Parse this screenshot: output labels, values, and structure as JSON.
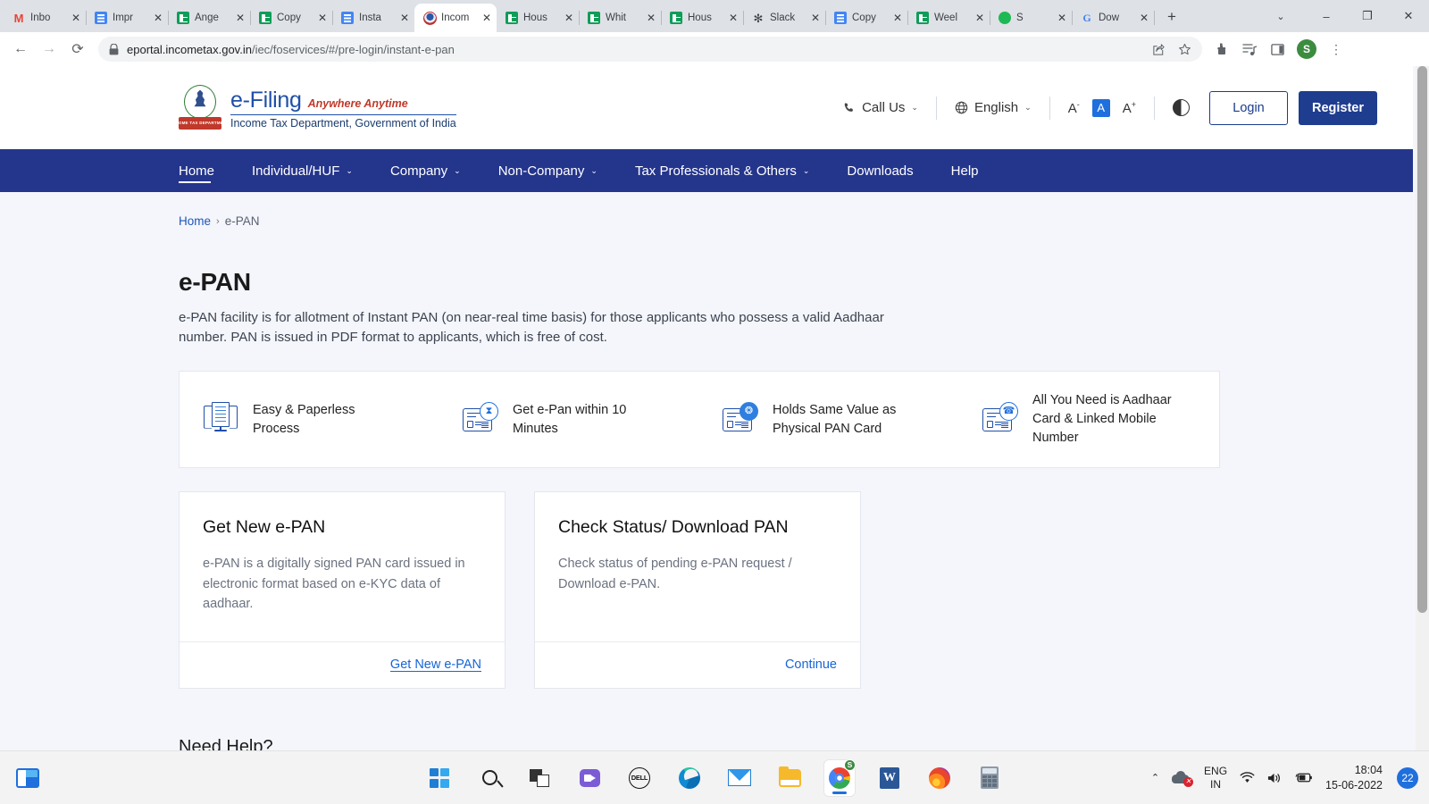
{
  "browser": {
    "tabs": [
      {
        "title": "Inbo",
        "icon": "gmail-icon",
        "active": false
      },
      {
        "title": "Impr",
        "icon": "google-docs-icon",
        "active": false
      },
      {
        "title": "Ange",
        "icon": "google-sheets-icon",
        "active": false
      },
      {
        "title": "Copy",
        "icon": "google-sheets-icon",
        "active": false
      },
      {
        "title": "Insta",
        "icon": "google-docs-icon",
        "active": false
      },
      {
        "title": "Incom",
        "icon": "income-tax-emblem-icon",
        "active": true
      },
      {
        "title": "Hous",
        "icon": "google-sheets-icon",
        "active": false
      },
      {
        "title": "Whit",
        "icon": "google-sheets-icon",
        "active": false
      },
      {
        "title": "Hous",
        "icon": "google-sheets-icon",
        "active": false
      },
      {
        "title": "Slack",
        "icon": "slack-icon",
        "active": false
      },
      {
        "title": "Copy",
        "icon": "google-docs-icon",
        "active": false
      },
      {
        "title": "Weel",
        "icon": "google-sheets-icon",
        "active": false
      },
      {
        "title": "S",
        "icon": "spotify-icon",
        "active": false
      },
      {
        "title": "Dow",
        "icon": "google-icon",
        "active": false
      }
    ],
    "new_tab_label": "+",
    "close_label": "✕",
    "window_controls": {
      "search_tabs": "⌄",
      "minimize": "–",
      "maximize": "❐",
      "close": "✕"
    },
    "toolbar": {
      "back": "←",
      "forward": "→",
      "reload": "⟳",
      "lock_icon": "lock-icon",
      "url": "eportal.incometax.gov.in",
      "url_path": "/iec/foservices/#/pre-login/instant-e-pan",
      "share": "share-icon",
      "bookmark": "star-icon",
      "extensions": "puzzle-icon",
      "media": "media-playlist-icon",
      "side_panel": "side-panel-icon",
      "profile_initial": "S",
      "menu": "⋮"
    }
  },
  "site": {
    "brand": {
      "emblem_text": "INCOME TAX DEPARTMENT",
      "title": "e-Filing",
      "tagline": "Anywhere Anytime",
      "subtitle": "Income Tax Department, Government of India"
    },
    "header_actions": {
      "call_us": "Call Us",
      "language": "English",
      "font_decrease": "A",
      "font_normal": "A",
      "font_increase": "A",
      "contrast": "contrast-icon",
      "login": "Login",
      "register": "Register"
    },
    "nav": [
      {
        "label": "Home",
        "has_caret": false,
        "active": true
      },
      {
        "label": "Individual/HUF",
        "has_caret": true,
        "active": false
      },
      {
        "label": "Company",
        "has_caret": true,
        "active": false
      },
      {
        "label": "Non-Company",
        "has_caret": true,
        "active": false
      },
      {
        "label": "Tax Professionals & Others",
        "has_caret": true,
        "active": false
      },
      {
        "label": "Downloads",
        "has_caret": false,
        "active": false
      },
      {
        "label": "Help",
        "has_caret": false,
        "active": false
      }
    ],
    "breadcrumb": {
      "home": "Home",
      "separator": "›",
      "current": "e-PAN"
    },
    "page": {
      "title": "e-PAN",
      "description": "e-PAN facility is for allotment of Instant PAN (on near-real time basis) for those applicants who possess a valid Aadhaar number. PAN is issued in PDF format to applicants, which is free of cost."
    },
    "features": [
      {
        "label": "Easy & Paperless Process",
        "icon": "monitor-document-icon"
      },
      {
        "label": "Get e-Pan within 10 Minutes",
        "icon": "id-card-hourglass-icon"
      },
      {
        "label": "Holds Same Value as Physical PAN Card",
        "icon": "id-card-fingerprint-icon"
      },
      {
        "label": "All You Need is Aadhaar Card & Linked Mobile Number",
        "icon": "id-card-clock-icon"
      }
    ],
    "cards": [
      {
        "title": "Get New e-PAN",
        "description": "e-PAN is a digitally signed PAN card issued in electronic format based on e-KYC data of aadhaar.",
        "link": "Get New e-PAN",
        "link_underlined": true
      },
      {
        "title": "Check Status/ Download PAN",
        "description": "Check status of pending e-PAN request / Download e-PAN.",
        "link": "Continue",
        "link_underlined": false
      }
    ],
    "need_help": "Need Help?",
    "colors": {
      "nav_blue": "#24358c",
      "brand_blue": "#1f4fa8",
      "link_blue": "#1565d8",
      "register_bg": "#1f3d8f",
      "page_bg": "#f4f6fb"
    }
  },
  "taskbar": {
    "widgets_icon": "widgets-icon",
    "apps": [
      {
        "name": "start-icon",
        "active": false
      },
      {
        "name": "search-icon",
        "active": false
      },
      {
        "name": "task-view-icon",
        "active": false
      },
      {
        "name": "chat-icon",
        "active": false
      },
      {
        "name": "dell-icon",
        "label": "DELL",
        "active": false
      },
      {
        "name": "edge-icon",
        "active": false
      },
      {
        "name": "mail-icon",
        "active": false
      },
      {
        "name": "file-explorer-icon",
        "active": false
      },
      {
        "name": "chrome-icon",
        "active": true,
        "badge": "S"
      },
      {
        "name": "word-icon",
        "label": "W",
        "active": false
      },
      {
        "name": "firefox-icon",
        "active": false
      },
      {
        "name": "calculator-icon",
        "active": false
      }
    ],
    "tray": {
      "chevron": "⌃",
      "onedrive": "onedrive-error-icon",
      "onedrive_error": "✕",
      "language_line1": "ENG",
      "language_line2": "IN",
      "wifi": "wifi-icon",
      "volume": "volume-icon",
      "battery": "battery-charging-icon",
      "time": "18:04",
      "date": "15-06-2022",
      "notification_count": "22"
    }
  }
}
